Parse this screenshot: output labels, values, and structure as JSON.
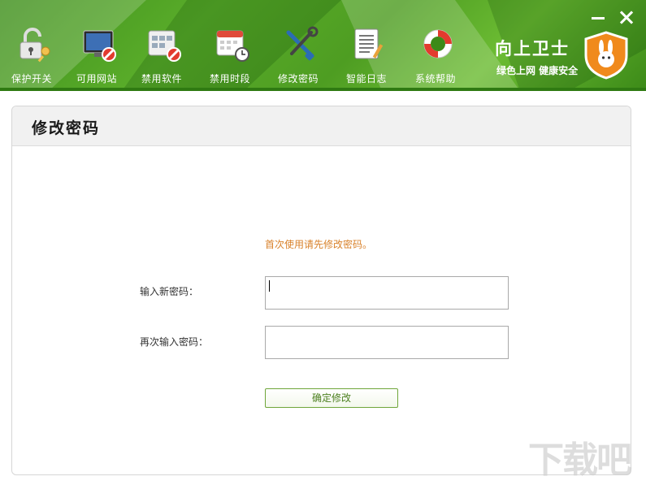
{
  "window": {
    "minimize_label": "—",
    "close_label": "✕"
  },
  "toolbar": {
    "items": [
      {
        "label": "保护开关",
        "icon": "unlock-key-icon"
      },
      {
        "label": "可用网站",
        "icon": "monitor-blocked-icon"
      },
      {
        "label": "禁用软件",
        "icon": "apps-blocked-icon"
      },
      {
        "label": "禁用时段",
        "icon": "calendar-clock-icon"
      },
      {
        "label": "修改密码",
        "icon": "tools-icon"
      },
      {
        "label": "智能日志",
        "icon": "log-document-icon"
      },
      {
        "label": "系统帮助",
        "icon": "lifebuoy-icon"
      }
    ]
  },
  "brand": {
    "name": "向上卫士",
    "slogan": "绿色上网 健康安全",
    "badge_icon": "rabbit-shield-icon"
  },
  "panel": {
    "title": "修改密码",
    "notice": "首次使用请先修改密码。",
    "new_password_label": "输入新密码：",
    "confirm_password_label": "再次输入密码：",
    "new_password_value": "",
    "confirm_password_value": "",
    "submit_label": "确定修改"
  },
  "watermark": "下载吧",
  "colors": {
    "header_green": "#4e9d22",
    "notice_orange": "#d9822b",
    "button_border": "#6fa63a"
  }
}
